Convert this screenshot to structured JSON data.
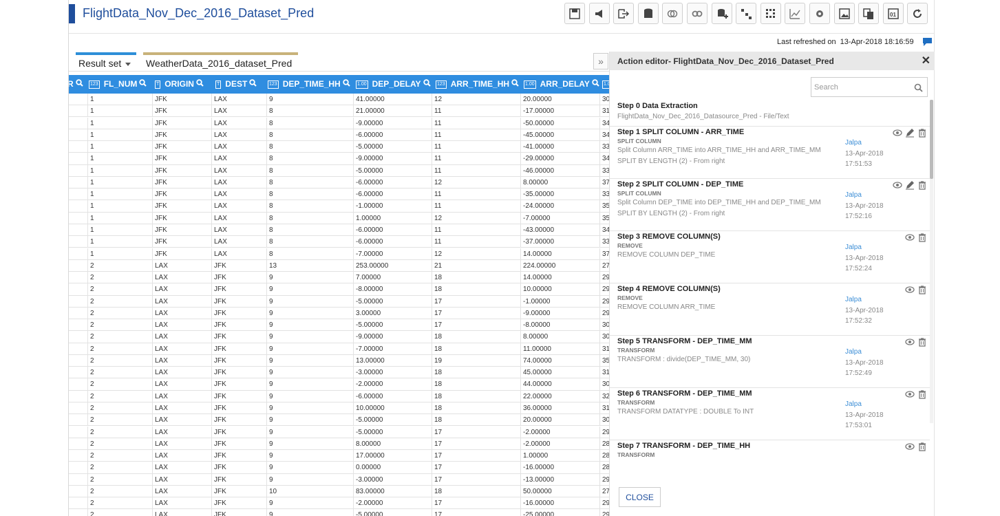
{
  "app": {
    "title": "FlightData_Nov_Dec_2016_Dataset_Pred"
  },
  "toolbar": {
    "icons": [
      "save-icon",
      "broadcast-icon",
      "export-icon",
      "database-icon",
      "merge-icon",
      "link-icon",
      "add-data-icon",
      "hierarchy-icon",
      "grid-icon",
      "chart-icon",
      "settings-icon",
      "image-icon",
      "copy-icon",
      "binary-icon",
      "refresh-icon"
    ]
  },
  "refresh": {
    "label": "Last refreshed on",
    "timestamp": "13-Apr-2018 18:16:59"
  },
  "tabs": [
    {
      "label": "Result set"
    },
    {
      "label": "WeatherData_2016_dataset_Pred"
    }
  ],
  "table": {
    "columns": [
      {
        "label": "R",
        "type": ""
      },
      {
        "label": "FL_NUM",
        "type": "123"
      },
      {
        "label": "ORIGIN",
        "type": "T"
      },
      {
        "label": "DEST",
        "type": "T"
      },
      {
        "label": "DEP_TIME_HH",
        "type": "123"
      },
      {
        "label": "DEP_DELAY",
        "type": "1.00"
      },
      {
        "label": "ARR_TIME_HH",
        "type": "123"
      },
      {
        "label": "ARR_DELAY",
        "type": "1.00"
      },
      {
        "label": "",
        "type": "1.00"
      }
    ],
    "rows": [
      [
        "",
        "1",
        "JFK",
        "LAX",
        "9",
        "41.00000",
        "12",
        "20.00000",
        "30"
      ],
      [
        "",
        "1",
        "JFK",
        "LAX",
        "8",
        "21.00000",
        "11",
        "-17.00000",
        "31"
      ],
      [
        "",
        "1",
        "JFK",
        "LAX",
        "8",
        "-9.00000",
        "11",
        "-50.00000",
        "34"
      ],
      [
        "",
        "1",
        "JFK",
        "LAX",
        "8",
        "-6.00000",
        "11",
        "-45.00000",
        "34"
      ],
      [
        "",
        "1",
        "JFK",
        "LAX",
        "8",
        "-5.00000",
        "11",
        "-41.00000",
        "33"
      ],
      [
        "",
        "1",
        "JFK",
        "LAX",
        "8",
        "-9.00000",
        "11",
        "-29.00000",
        "34"
      ],
      [
        "",
        "1",
        "JFK",
        "LAX",
        "8",
        "-5.00000",
        "11",
        "-46.00000",
        "33"
      ],
      [
        "",
        "1",
        "JFK",
        "LAX",
        "8",
        "-6.00000",
        "12",
        "8.00000",
        "37"
      ],
      [
        "",
        "1",
        "JFK",
        "LAX",
        "8",
        "-6.00000",
        "11",
        "-35.00000",
        "33"
      ],
      [
        "",
        "1",
        "JFK",
        "LAX",
        "8",
        "-1.00000",
        "11",
        "-24.00000",
        "35"
      ],
      [
        "",
        "1",
        "JFK",
        "LAX",
        "8",
        "1.00000",
        "12",
        "-7.00000",
        "35"
      ],
      [
        "",
        "1",
        "JFK",
        "LAX",
        "8",
        "-6.00000",
        "11",
        "-43.00000",
        "34"
      ],
      [
        "",
        "1",
        "JFK",
        "LAX",
        "8",
        "-6.00000",
        "11",
        "-37.00000",
        "33"
      ],
      [
        "",
        "1",
        "JFK",
        "LAX",
        "8",
        "-7.00000",
        "12",
        "14.00000",
        "37"
      ],
      [
        "",
        "2",
        "LAX",
        "JFK",
        "13",
        "253.00000",
        "21",
        "224.00000",
        "27"
      ],
      [
        "",
        "2",
        "LAX",
        "JFK",
        "9",
        "7.00000",
        "18",
        "14.00000",
        "29"
      ],
      [
        "",
        "2",
        "LAX",
        "JFK",
        "9",
        "-8.00000",
        "18",
        "10.00000",
        "29"
      ],
      [
        "",
        "2",
        "LAX",
        "JFK",
        "9",
        "-5.00000",
        "17",
        "-1.00000",
        "29"
      ],
      [
        "",
        "2",
        "LAX",
        "JFK",
        "9",
        "3.00000",
        "17",
        "-9.00000",
        "29"
      ],
      [
        "",
        "2",
        "LAX",
        "JFK",
        "9",
        "-5.00000",
        "17",
        "-8.00000",
        "30"
      ],
      [
        "",
        "2",
        "LAX",
        "JFK",
        "9",
        "-9.00000",
        "18",
        "8.00000",
        "30"
      ],
      [
        "",
        "2",
        "LAX",
        "JFK",
        "9",
        "-7.00000",
        "18",
        "11.00000",
        "31"
      ],
      [
        "",
        "2",
        "LAX",
        "JFK",
        "9",
        "13.00000",
        "19",
        "74.00000",
        "35"
      ],
      [
        "",
        "2",
        "LAX",
        "JFK",
        "9",
        "-3.00000",
        "18",
        "45.00000",
        "31"
      ],
      [
        "",
        "2",
        "LAX",
        "JFK",
        "9",
        "-2.00000",
        "18",
        "44.00000",
        "30"
      ],
      [
        "",
        "2",
        "LAX",
        "JFK",
        "9",
        "-6.00000",
        "18",
        "22.00000",
        "32"
      ],
      [
        "",
        "2",
        "LAX",
        "JFK",
        "9",
        "10.00000",
        "18",
        "36.00000",
        "31"
      ],
      [
        "",
        "2",
        "LAX",
        "JFK",
        "9",
        "-5.00000",
        "18",
        "20.00000",
        "30"
      ],
      [
        "",
        "2",
        "LAX",
        "JFK",
        "9",
        "-5.00000",
        "17",
        "-2.00000",
        "29"
      ],
      [
        "",
        "2",
        "LAX",
        "JFK",
        "9",
        "8.00000",
        "17",
        "-2.00000",
        "28"
      ],
      [
        "",
        "2",
        "LAX",
        "JFK",
        "9",
        "17.00000",
        "17",
        "1.00000",
        "28"
      ],
      [
        "",
        "2",
        "LAX",
        "JFK",
        "9",
        "0.00000",
        "17",
        "-16.00000",
        "28"
      ],
      [
        "",
        "2",
        "LAX",
        "JFK",
        "9",
        "-3.00000",
        "17",
        "-13.00000",
        "29"
      ],
      [
        "",
        "2",
        "LAX",
        "JFK",
        "10",
        "83.00000",
        "18",
        "50.00000",
        "27"
      ],
      [
        "",
        "2",
        "LAX",
        "JFK",
        "9",
        "-2.00000",
        "17",
        "-16.00000",
        "29"
      ],
      [
        "",
        "2",
        "LAX",
        "JFK",
        "9",
        "-5.00000",
        "17",
        "-25.00000",
        "29"
      ]
    ]
  },
  "panel": {
    "title": "Action editor- FlightData_Nov_Dec_2016_Dataset_Pred",
    "search_placeholder": "Search",
    "close_label": "CLOSE",
    "steps": [
      {
        "title": "Step 0 Data Extraction",
        "sub": "",
        "lines": [
          "FlightData_Nov_Dec_2016_Datasource_Pred - File/Text"
        ],
        "user": "",
        "date": "",
        "time": "",
        "editable": false,
        "icons": false
      },
      {
        "title": "Step 1 SPLIT COLUMN - ARR_TIME",
        "sub": "SPLIT COLUMN",
        "lines": [
          "Split Column ARR_TIME into ARR_TIME_HH and ARR_TIME_MM",
          "SPLIT BY LENGTH (2) - From right"
        ],
        "user": "Jalpa",
        "date": "13-Apr-2018",
        "time": "17:51:53",
        "editable": true,
        "icons": true
      },
      {
        "title": "Step 2 SPLIT COLUMN - DEP_TIME",
        "sub": "SPLIT COLUMN",
        "lines": [
          "Split Column DEP_TIME into DEP_TIME_HH and DEP_TIME_MM",
          "SPLIT BY LENGTH (2) - From right"
        ],
        "user": "Jalpa",
        "date": "13-Apr-2018",
        "time": "17:52:16",
        "editable": true,
        "icons": true
      },
      {
        "title": "Step 3 REMOVE COLUMN(S)",
        "sub": "REMOVE",
        "lines": [
          "REMOVE COLUMN DEP_TIME"
        ],
        "user": "Jalpa",
        "date": "13-Apr-2018",
        "time": "17:52:24",
        "editable": false,
        "icons": true
      },
      {
        "title": "Step 4 REMOVE COLUMN(S)",
        "sub": "REMOVE",
        "lines": [
          "REMOVE COLUMN ARR_TIME"
        ],
        "user": "Jalpa",
        "date": "13-Apr-2018",
        "time": "17:52:32",
        "editable": false,
        "icons": true
      },
      {
        "title": "Step 5 TRANSFORM - DEP_TIME_MM",
        "sub": "TRANSFORM",
        "lines": [
          "TRANSFORM : divide(DEP_TIME_MM, 30)"
        ],
        "user": "Jalpa",
        "date": "13-Apr-2018",
        "time": "17:52:49",
        "editable": false,
        "icons": true
      },
      {
        "title": "Step 6 TRANSFORM - DEP_TIME_MM",
        "sub": "TRANSFORM",
        "lines": [
          "TRANSFORM DATATYPE : DOUBLE To INT"
        ],
        "user": "Jalpa",
        "date": "13-Apr-2018",
        "time": "17:53:01",
        "editable": false,
        "icons": true
      },
      {
        "title": "Step 7 TRANSFORM - DEP_TIME_HH",
        "sub": "TRANSFORM",
        "lines": [],
        "user": "",
        "date": "",
        "time": "",
        "editable": false,
        "icons": true
      }
    ]
  }
}
